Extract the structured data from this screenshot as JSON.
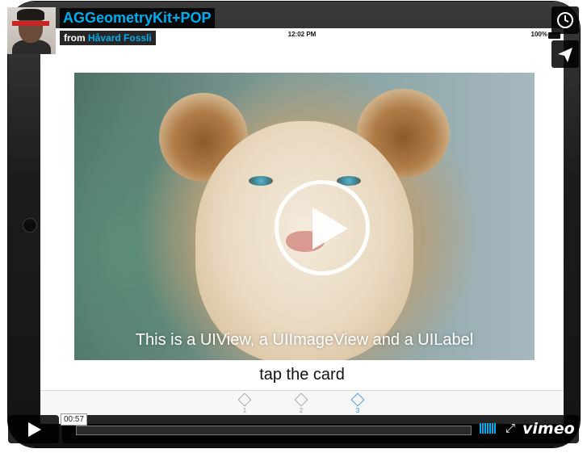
{
  "video": {
    "title": "AGGeometryKit+POP",
    "from_label": "from",
    "author": "Håvard Fossli",
    "timecode": "00:57",
    "progress_fraction": 0.0
  },
  "ipad": {
    "status_time": "12:02 PM",
    "battery": "100%",
    "card_caption": "This is a UIView, a UIImageView and a UILabel",
    "instruction": "tap the card",
    "tabs": [
      {
        "label": "1",
        "active": false
      },
      {
        "label": "2",
        "active": false
      },
      {
        "label": "3",
        "active": true
      }
    ]
  },
  "controls": {
    "brand": "vimeo",
    "fullscreen_icon": "fullscreen-icon",
    "volume_icon": "volume-bars-icon",
    "watch_later_icon": "clock-icon",
    "share_icon": "paper-plane-icon",
    "play_icon": "play-icon"
  },
  "colors": {
    "accent": "#00adef",
    "overlay": "#000000"
  }
}
